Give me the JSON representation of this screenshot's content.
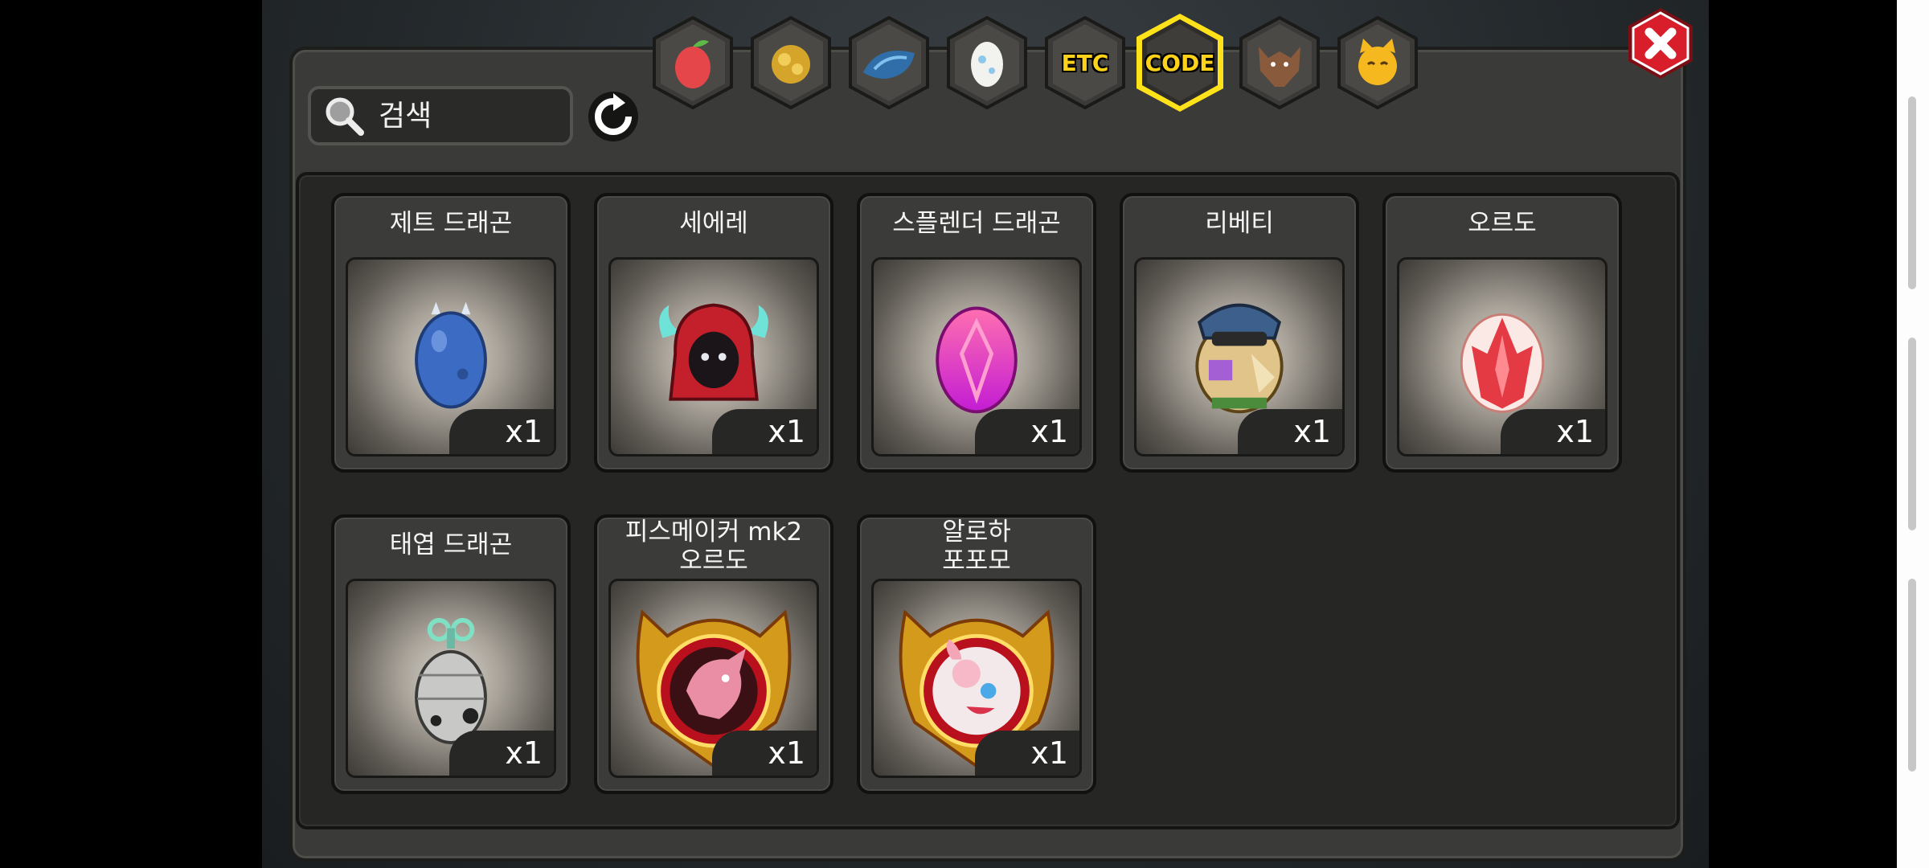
{
  "search": {
    "placeholder": "검색"
  },
  "tabs": [
    {
      "name": "fruit-icon"
    },
    {
      "name": "gold-ore-icon"
    },
    {
      "name": "blue-scale-icon"
    },
    {
      "name": "egg-icon"
    },
    {
      "name": "etc",
      "label": "ETC"
    },
    {
      "name": "code",
      "label": "CODE",
      "selected": true
    },
    {
      "name": "wolf-icon"
    },
    {
      "name": "cat-face-icon"
    }
  ],
  "items": [
    {
      "title": "제트 드래곤",
      "qty": "x1"
    },
    {
      "title": "세에레",
      "qty": "x1"
    },
    {
      "title": "스플렌더 드래곤",
      "qty": "x1"
    },
    {
      "title": "리베티",
      "qty": "x1"
    },
    {
      "title": "오르도",
      "qty": "x1"
    },
    {
      "title": "태엽 드래곤",
      "qty": "x1"
    },
    {
      "title": "피스메이커 mk2\n오르도",
      "qty": "x1"
    },
    {
      "title": "알로하\n포포모",
      "qty": "x1"
    }
  ],
  "colors": {
    "accent": "#ffd21a",
    "close": "#d81e2a"
  }
}
